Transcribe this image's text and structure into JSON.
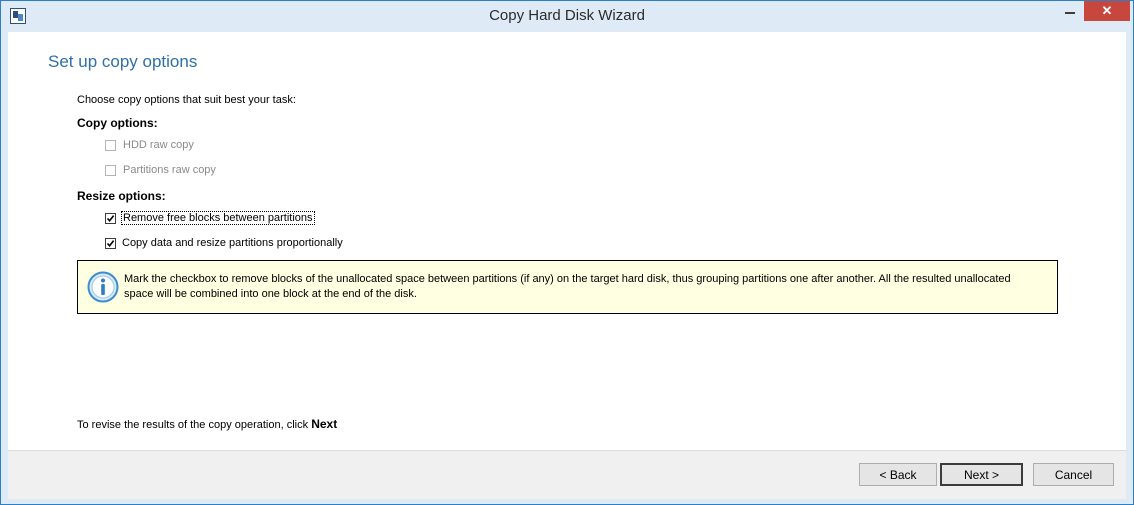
{
  "window": {
    "title": "Copy Hard Disk Wizard",
    "close_glyph": "✕",
    "accent_color": "#2a7fc9",
    "close_color": "#c7463d"
  },
  "page": {
    "heading": "Set up copy options",
    "intro": "Choose copy options that suit best your task:",
    "copy_options_label": "Copy options:",
    "copy_options": [
      {
        "label": "HDD raw copy",
        "checked": false,
        "enabled": false
      },
      {
        "label": "Partitions raw copy",
        "checked": false,
        "enabled": false
      }
    ],
    "resize_options_label": "Resize options:",
    "resize_options": [
      {
        "label": "Remove free blocks between partitions",
        "checked": true,
        "enabled": true,
        "focused": true
      },
      {
        "label": "Copy data and resize partitions proportionally",
        "checked": true,
        "enabled": true
      }
    ],
    "info": {
      "icon": "info-icon",
      "text": "Mark the checkbox to remove blocks of the unallocated space between partitions (if any) on the target hard disk, thus grouping partitions one after another. All the resulted unallocated space will be combined into one block at the end of the disk."
    },
    "hint_prefix": "To revise the results of the copy operation, click",
    "hint_action": "Next"
  },
  "footer": {
    "back_label": "< Back",
    "next_label": "Next >",
    "cancel_label": "Cancel"
  }
}
